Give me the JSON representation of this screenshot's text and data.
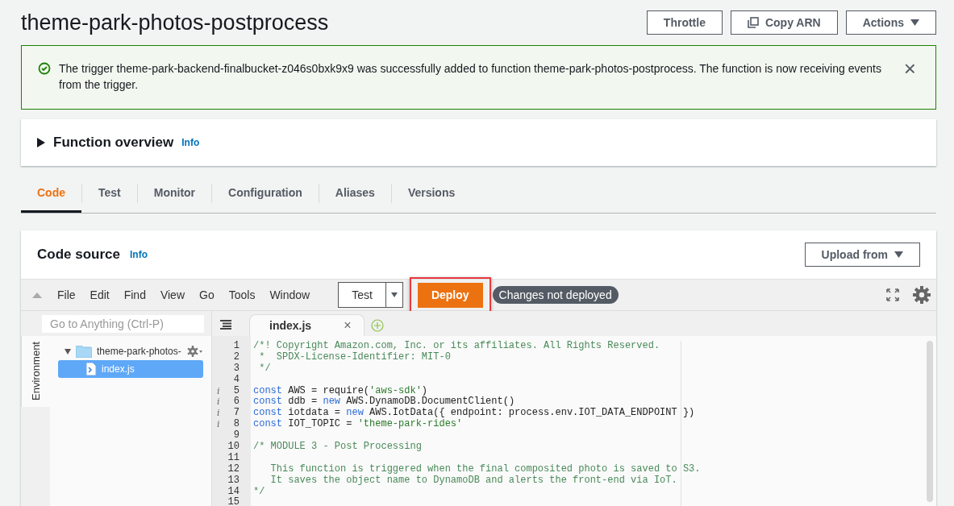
{
  "title": "theme-park-photos-postprocess",
  "header_buttons": [
    {
      "label": "Throttle",
      "kind": "plain"
    },
    {
      "label": "Copy ARN",
      "kind": "copy"
    },
    {
      "label": "Actions",
      "kind": "dropdown"
    }
  ],
  "banner": {
    "message": "The trigger theme-park-backend-finalbucket-z046s0bxk9x9 was successfully added to function theme-park-photos-postprocess. The function is now receiving events from the trigger.",
    "close": "×"
  },
  "overview": {
    "title": "Function overview",
    "info": "Info",
    "expanded": false
  },
  "tabs": [
    {
      "label": "Code",
      "selected": true
    },
    {
      "label": "Test",
      "selected": false
    },
    {
      "label": "Monitor",
      "selected": false
    },
    {
      "label": "Configuration",
      "selected": false
    },
    {
      "label": "Aliases",
      "selected": false
    },
    {
      "label": "Versions",
      "selected": false
    }
  ],
  "code_source": {
    "title": "Code source",
    "info": "Info",
    "upload": "Upload from"
  },
  "menu": [
    "File",
    "Edit",
    "Find",
    "View",
    "Go",
    "Tools",
    "Window"
  ],
  "test_button": "Test",
  "deploy": {
    "label": "Deploy",
    "highlighted": true
  },
  "status_pill": "Changes not deployed",
  "search": {
    "placeholder": "Go to Anything (Ctrl-P)"
  },
  "side_tab": "Environment",
  "tree": [
    {
      "name": "theme-park-photos-",
      "kind": "folder",
      "expanded": true,
      "selected": false,
      "children": [
        {
          "name": "index.js",
          "kind": "file",
          "selected": true
        }
      ]
    }
  ],
  "editor_tabs": [
    {
      "label": "index.js",
      "selected": true,
      "close": "×"
    }
  ],
  "code": [
    {
      "number": "1",
      "tokens": [
        {
          "kind": "comment",
          "text": "/*! Copyright Amazon.com, Inc. or its affiliates. All Rights Reserved."
        }
      ]
    },
    {
      "number": "2",
      "tokens": [
        {
          "kind": "comment",
          "text": " *  SPDX-License-Identifier: MIT-0"
        }
      ]
    },
    {
      "number": "3",
      "tokens": [
        {
          "kind": "comment",
          "text": " */"
        }
      ]
    },
    {
      "number": "4"
    },
    {
      "number": "5",
      "hint": "i",
      "tokens": [
        {
          "kind": "keyword",
          "text": "const"
        },
        {
          "kind": "plain",
          "text": " AWS = require("
        },
        {
          "kind": "string",
          "text": "'aws-sdk'"
        },
        {
          "kind": "plain",
          "text": ")"
        }
      ]
    },
    {
      "number": "6",
      "hint": "i",
      "tokens": [
        {
          "kind": "keyword",
          "text": "const"
        },
        {
          "kind": "plain",
          "text": " ddb = "
        },
        {
          "kind": "keyword",
          "text": "new"
        },
        {
          "kind": "plain",
          "text": " AWS.DynamoDB.DocumentClient()"
        }
      ]
    },
    {
      "number": "7",
      "hint": "i",
      "tokens": [
        {
          "kind": "keyword",
          "text": "const"
        },
        {
          "kind": "plain",
          "text": " iotdata = "
        },
        {
          "kind": "keyword",
          "text": "new"
        },
        {
          "kind": "plain",
          "text": " AWS.IotData({ endpoint: process.env.IOT_DATA_ENDPOINT })"
        }
      ]
    },
    {
      "number": "8",
      "hint": "i",
      "tokens": [
        {
          "kind": "keyword",
          "text": "const"
        },
        {
          "kind": "plain",
          "text": " IOT_TOPIC = "
        },
        {
          "kind": "string",
          "text": "'theme-park-rides'"
        }
      ]
    },
    {
      "number": "9"
    },
    {
      "number": "10",
      "tokens": [
        {
          "kind": "comment",
          "text": "/* MODULE 3 - Post Processing"
        }
      ]
    },
    {
      "number": "11"
    },
    {
      "number": "12",
      "tokens": [
        {
          "kind": "comment",
          "text": "   This function is triggered when the final composited photo is saved to S3."
        }
      ]
    },
    {
      "number": "13",
      "tokens": [
        {
          "kind": "comment",
          "text": "   It saves the object name to DynamoDB and alerts the front-end via IoT."
        }
      ]
    },
    {
      "number": "14",
      "tokens": [
        {
          "kind": "comment",
          "text": "*/"
        }
      ]
    },
    {
      "number": "15"
    }
  ]
}
